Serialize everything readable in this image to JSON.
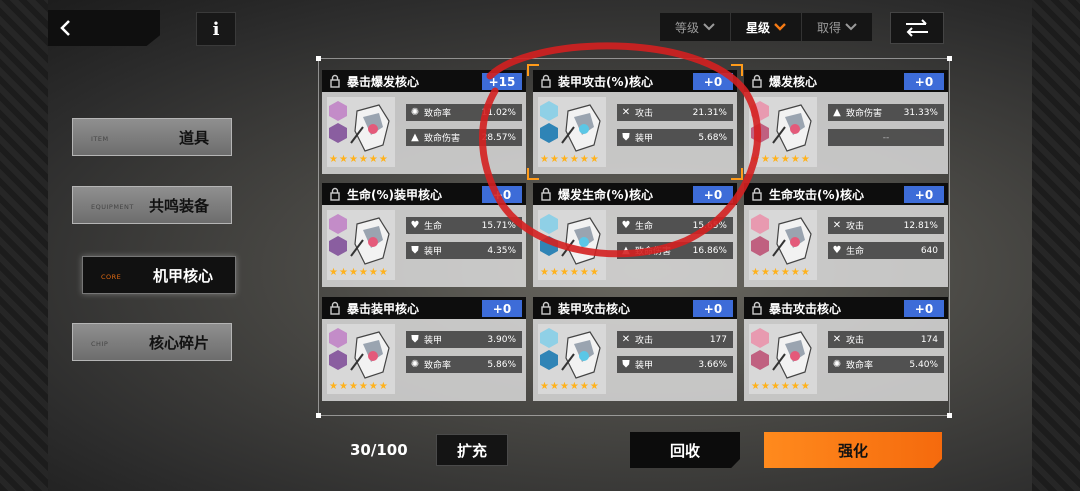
{
  "topbar": {
    "info_label": "i",
    "sort": [
      {
        "label": "等级",
        "active": false
      },
      {
        "label": "星级",
        "active": true
      },
      {
        "label": "取得",
        "active": false
      }
    ]
  },
  "nav": [
    {
      "sub": "ITEM",
      "label": "道具",
      "active": false
    },
    {
      "sub": "EQUIPMENT",
      "label": "共鸣装备",
      "active": false
    },
    {
      "sub": "CORE",
      "label": "机甲核心",
      "active": true
    },
    {
      "sub": "CHIP",
      "label": "核心碎片",
      "active": false
    }
  ],
  "cards": [
    {
      "name": "暴击爆发核心",
      "level": "+15",
      "stats": [
        {
          "icon": "crit-rate-icon",
          "name": "致命率",
          "value": "11.02%"
        },
        {
          "icon": "crit-damage-icon",
          "name": "致命伤害",
          "value": "28.57%"
        }
      ]
    },
    {
      "name": "装甲攻击(%)核心",
      "level": "+0",
      "selected": true,
      "stats": [
        {
          "icon": "attack-icon",
          "name": "攻击",
          "value": "21.31%"
        },
        {
          "icon": "armor-icon",
          "name": "装甲",
          "value": "5.68%"
        }
      ]
    },
    {
      "name": "爆发核心",
      "level": "+0",
      "stats": [
        {
          "icon": "crit-damage-icon",
          "name": "致命伤害",
          "value": "31.33%"
        },
        {
          "icon": "",
          "name": "--",
          "value": ""
        }
      ]
    },
    {
      "name": "生命(%)装甲核心",
      "level": "+0",
      "stats": [
        {
          "icon": "hp-icon",
          "name": "生命",
          "value": "15.71%"
        },
        {
          "icon": "armor-icon",
          "name": "装甲",
          "value": "4.35%"
        }
      ]
    },
    {
      "name": "爆发生命(%)核心",
      "level": "+0",
      "stats": [
        {
          "icon": "hp-icon",
          "name": "生命",
          "value": "15.65%"
        },
        {
          "icon": "crit-damage-icon",
          "name": "致命伤害",
          "value": "16.86%"
        }
      ]
    },
    {
      "name": "生命攻击(%)核心",
      "level": "+0",
      "stats": [
        {
          "icon": "attack-icon",
          "name": "攻击",
          "value": "12.81%"
        },
        {
          "icon": "hp-icon",
          "name": "生命",
          "value": "640"
        }
      ]
    },
    {
      "name": "暴击装甲核心",
      "level": "+0",
      "stats": [
        {
          "icon": "armor-icon",
          "name": "装甲",
          "value": "3.90%"
        },
        {
          "icon": "crit-rate-icon",
          "name": "致命率",
          "value": "5.86%"
        }
      ]
    },
    {
      "name": "装甲攻击核心",
      "level": "+0",
      "stats": [
        {
          "icon": "attack-icon",
          "name": "攻击",
          "value": "177"
        },
        {
          "icon": "armor-icon",
          "name": "装甲",
          "value": "3.66%"
        }
      ]
    },
    {
      "name": "暴击攻击核心",
      "level": "+0",
      "stats": [
        {
          "icon": "attack-icon",
          "name": "攻击",
          "value": "174"
        },
        {
          "icon": "crit-rate-icon",
          "name": "致命率",
          "value": "5.40%"
        }
      ]
    }
  ],
  "stars_per_card": 6,
  "bottom": {
    "capacity": "30/100",
    "expand_label": "扩充",
    "recycle_label": "回收",
    "enhance_label": "强化"
  },
  "colors": {
    "accent_orange": "#f57a14",
    "level_badge_blue": "#3d6cd8",
    "star_gold": "#ffb21c",
    "annotation_red": "#d42020"
  }
}
